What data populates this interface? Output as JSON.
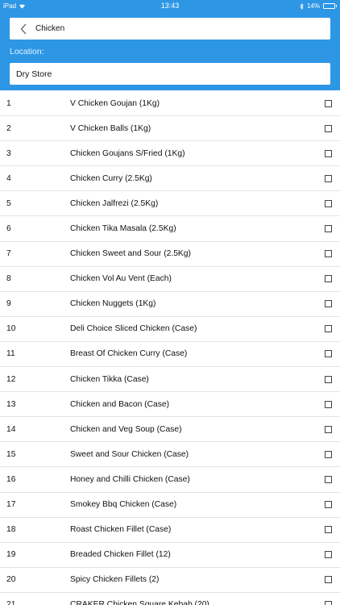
{
  "status_bar": {
    "device": "iPad",
    "time": "13:43",
    "battery": "14%",
    "battery_level": 0.14,
    "icons": [
      "wifi-icon",
      "bluetooth-icon",
      "battery-icon"
    ]
  },
  "header": {
    "search_value": "Chicken",
    "location_label": "Location:",
    "location_value": "Dry Store",
    "accent_color": "#2d97e6"
  },
  "items": [
    {
      "num": "1",
      "name": "V Chicken Goujan (1Kg)"
    },
    {
      "num": "2",
      "name": "V Chicken Balls (1Kg)"
    },
    {
      "num": "3",
      "name": "Chicken Goujans S/Fried (1Kg)"
    },
    {
      "num": "4",
      "name": "Chicken Curry (2.5Kg)"
    },
    {
      "num": "5",
      "name": "Chicken Jalfrezi (2.5Kg)"
    },
    {
      "num": "6",
      "name": "Chicken Tika Masala (2.5Kg)"
    },
    {
      "num": "7",
      "name": "Chicken Sweet and Sour (2.5Kg)"
    },
    {
      "num": "8",
      "name": "Chicken Vol Au Vent (Each)"
    },
    {
      "num": "9",
      "name": "Chicken Nuggets (1Kg)"
    },
    {
      "num": "10",
      "name": "Deli Choice Sliced Chicken (Case)"
    },
    {
      "num": "11",
      "name": "Breast Of Chicken Curry (Case)"
    },
    {
      "num": "12",
      "name": "Chicken Tikka (Case)"
    },
    {
      "num": "13",
      "name": "Chicken and Bacon (Case)"
    },
    {
      "num": "14",
      "name": "Chicken and Veg Soup (Case)"
    },
    {
      "num": "15",
      "name": "Sweet and Sour Chicken (Case)"
    },
    {
      "num": "16",
      "name": "Honey and Chilli Chicken  (Case)"
    },
    {
      "num": "17",
      "name": "Smokey Bbq Chicken  (Case)"
    },
    {
      "num": "18",
      "name": "Roast Chicken Fillet (Case)"
    },
    {
      "num": "19",
      "name": "Breaded Chicken Fillet (12)"
    },
    {
      "num": "20",
      "name": "Spicy Chicken Fillets (2)"
    },
    {
      "num": "21",
      "name": "CRAKER Chicken Square Kebab (20)"
    }
  ]
}
